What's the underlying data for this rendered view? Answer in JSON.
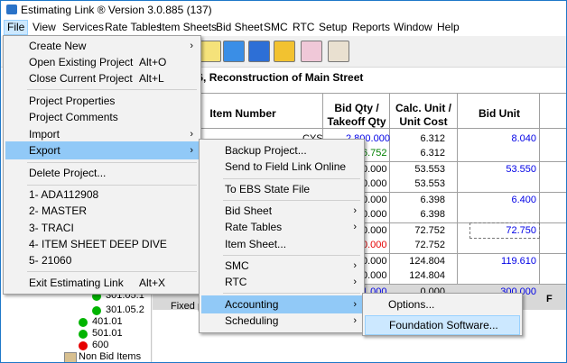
{
  "app": {
    "title": "Estimating Link ® Version  3.0.885 (137)"
  },
  "menubar": [
    "File",
    "View",
    "Services",
    "Rate Tables",
    "Item Sheets",
    "Bid Sheet",
    "SMC",
    "RTC",
    "Setup",
    "Reports",
    "Window",
    "Help"
  ],
  "project": {
    "title": "o. 123456, Reconstruction of Main Street"
  },
  "grid": {
    "headers": {
      "item": "Item Number",
      "qty": "Bid Qty /\nTakeoff Qty",
      "calc": "Calc. Unit /\nUnit Cost",
      "bid": "Bid Unit"
    },
    "rows": [
      {
        "unit": "CYS",
        "qty": "2,800.000",
        "qty2": "6.752",
        "calc": "6.312",
        "calc2": "6.312",
        "bid": "8.040"
      },
      {
        "qty": "0.000",
        "qty2": "0.000",
        "calc": "53.553",
        "calc2": "53.553",
        "bid": "53.550"
      },
      {
        "qty": "0.000",
        "qty2": "0.000",
        "calc": "6.398",
        "calc2": "6.398",
        "bid": "6.400"
      },
      {
        "qty": "0.000",
        "qty2": "0.000",
        "calc": "72.752",
        "calc2": "72.752",
        "bid": "72.750"
      },
      {
        "qty": "0.000",
        "qty2": "0.000",
        "calc": "124.804",
        "calc2": "124.804",
        "bid": "119.610"
      },
      {
        "qty": "1.000",
        "calc": "0.000",
        "bid": "300.000",
        "flag": "F"
      }
    ],
    "fixed_label": "Fixed p"
  },
  "tree": [
    {
      "label": "301.05.1",
      "color": "#00b400"
    },
    {
      "label": "301.05.2",
      "color": "#00b400"
    },
    {
      "label": "401.01",
      "color": "#00b400"
    },
    {
      "label": "501.01",
      "color": "#00b400"
    },
    {
      "label": "600",
      "color": "#e60000"
    },
    {
      "label": "Non Bid Items",
      "color": ""
    }
  ],
  "file_menu": {
    "items": [
      {
        "label": "Create New",
        "shortcut": "",
        "arrow": "›"
      },
      {
        "label": "Open Existing Project",
        "shortcut": "Alt+O",
        "arrow": ""
      },
      {
        "label": "Close Current Project",
        "shortcut": "Alt+L",
        "arrow": ""
      },
      {
        "label": "Project Properties",
        "shortcut": "",
        "arrow": ""
      },
      {
        "label": "Project Comments",
        "shortcut": "",
        "arrow": ""
      },
      {
        "label": "Import",
        "shortcut": "",
        "arrow": "›"
      },
      {
        "label": "Export",
        "shortcut": "",
        "arrow": "›"
      },
      {
        "label": "Delete Project...",
        "shortcut": "",
        "arrow": ""
      },
      {
        "label": "1- ADA112908",
        "shortcut": "",
        "arrow": ""
      },
      {
        "label": "2- MASTER",
        "shortcut": "",
        "arrow": ""
      },
      {
        "label": "3- TRACI",
        "shortcut": "",
        "arrow": ""
      },
      {
        "label": "4- ITEM SHEET DEEP DIVE",
        "shortcut": "",
        "arrow": ""
      },
      {
        "label": "5- 21060",
        "shortcut": "",
        "arrow": ""
      },
      {
        "label": "Exit Estimating Link",
        "shortcut": "Alt+X",
        "arrow": ""
      }
    ]
  },
  "export_menu": {
    "items": [
      {
        "label": "Backup Project...",
        "arrow": ""
      },
      {
        "label": "Send to Field Link Online",
        "arrow": ""
      },
      {
        "label": "To EBS State File",
        "arrow": ""
      },
      {
        "label": "Bid Sheet",
        "arrow": "›"
      },
      {
        "label": "Rate Tables",
        "arrow": "›"
      },
      {
        "label": "Item Sheet...",
        "arrow": ""
      },
      {
        "label": "SMC",
        "arrow": "›"
      },
      {
        "label": "RTC",
        "arrow": "›"
      },
      {
        "label": "Accounting",
        "arrow": "›"
      },
      {
        "label": "Scheduling",
        "arrow": "›"
      }
    ]
  },
  "accounting_menu": {
    "items": [
      {
        "label": "Options..."
      },
      {
        "label": "Foundation Software..."
      }
    ]
  }
}
